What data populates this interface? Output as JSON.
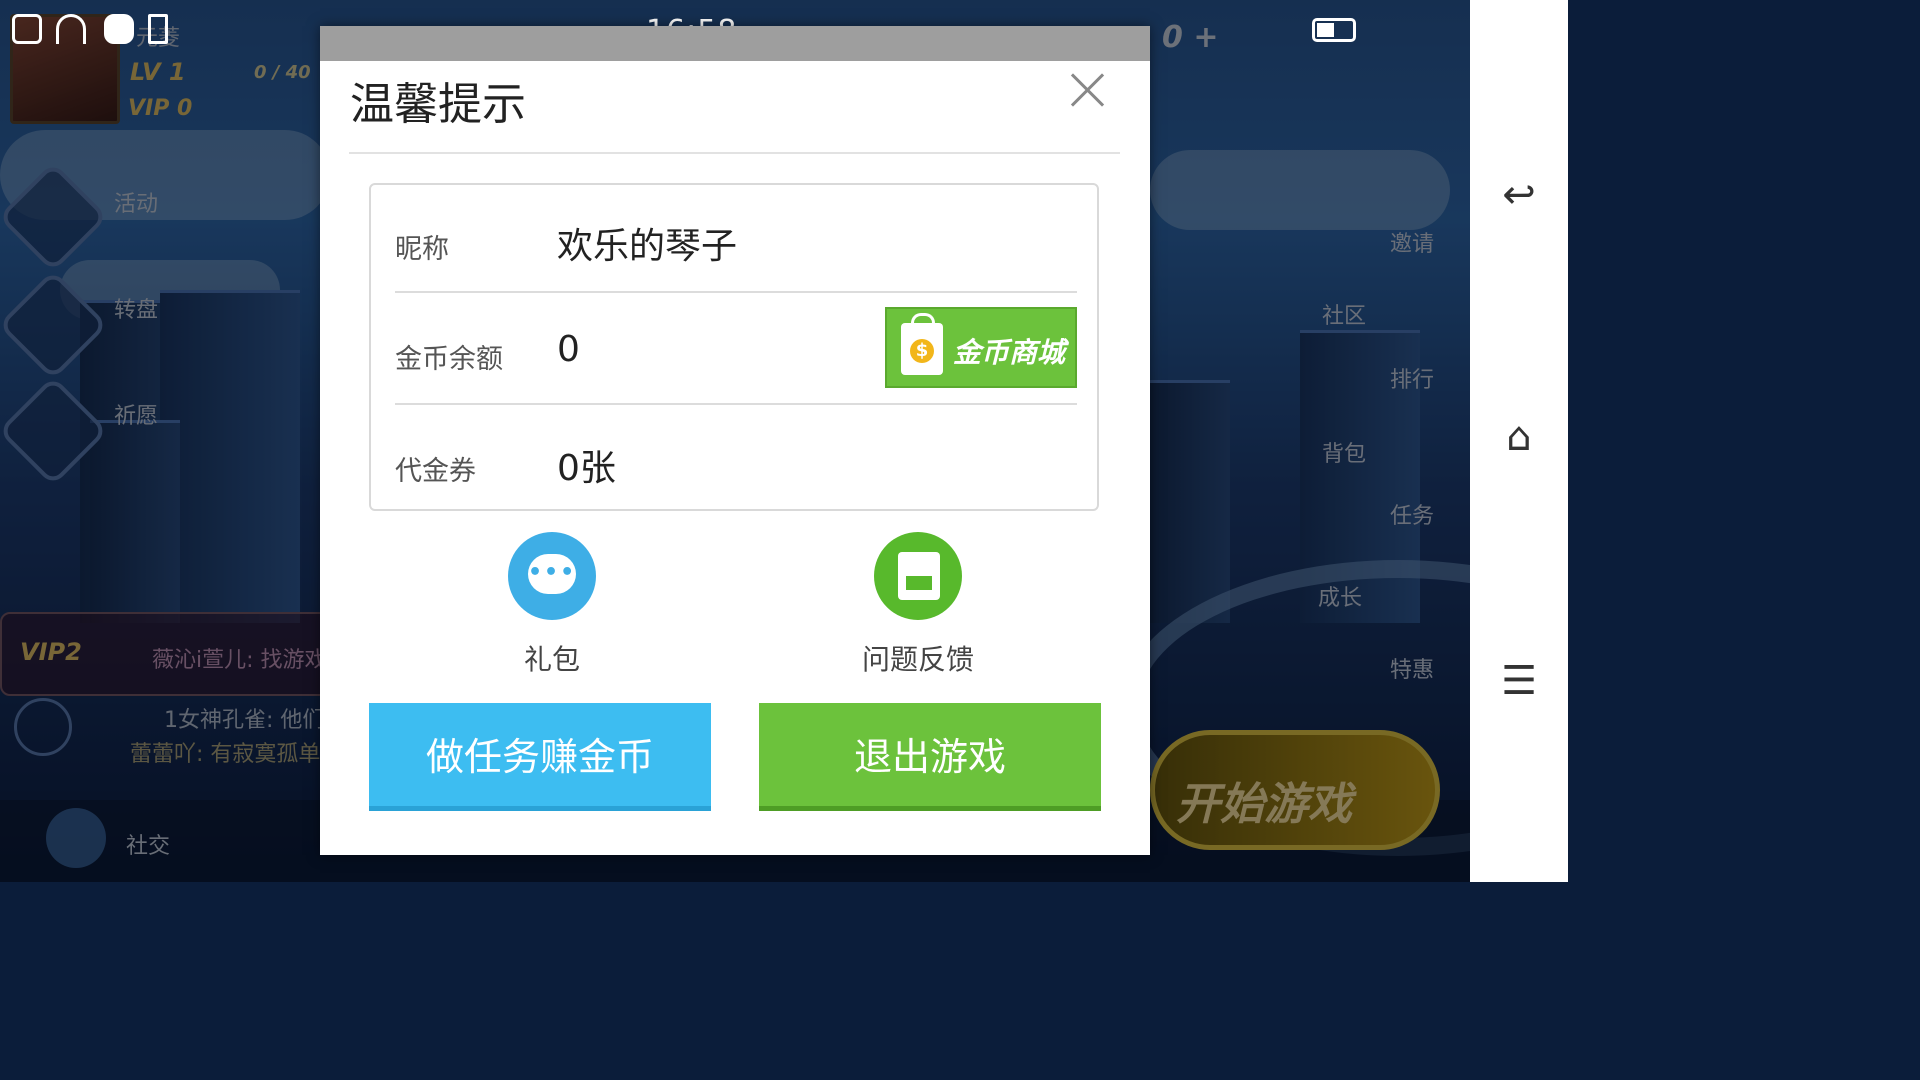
{
  "status_bar": {
    "time": "16:58"
  },
  "hud": {
    "player_name_fragment": "元菱",
    "level": "LV 1",
    "exp": "0 / 40",
    "vip": "VIP 0",
    "coins": "0 +"
  },
  "left_menu": [
    {
      "label": "活动"
    },
    {
      "label": "转盘"
    },
    {
      "label": "祈愿"
    }
  ],
  "chat": {
    "vip_badge": "VIP2",
    "line1": "薇沁i萱儿: 找游戏",
    "line2": "1女神孔雀: 他们",
    "line3": "蕾蕾吖: 有寂寞孤单"
  },
  "bottom_menu": [
    {
      "label": "社交"
    }
  ],
  "right_menu": [
    {
      "label": "邀请"
    },
    {
      "label": "社区"
    },
    {
      "label": "排行"
    },
    {
      "label": "背包"
    },
    {
      "label": "任务"
    },
    {
      "label": "成长"
    },
    {
      "label": "特惠"
    }
  ],
  "start_button": {
    "label": "开始游戏"
  },
  "dialog": {
    "title": "温馨提示",
    "nickname_label": "昵称",
    "nickname_value": "欢乐的琴子",
    "coin_label": "金币余额",
    "coin_value": "0",
    "shop_button": "金币商城",
    "voucher_label": "代金券",
    "voucher_value": "0张",
    "gift_label": "礼包",
    "feedback_label": "问题反馈",
    "task_button": "做任务赚金币",
    "exit_button": "退出游戏"
  },
  "colors": {
    "blue": "#3dbdf1",
    "green": "#6cc23c",
    "coin": "#f2b61a"
  },
  "icons": [
    "sim-icon",
    "wifi-icon",
    "android-icon",
    "usb-icon",
    "battery-icon",
    "close-icon",
    "shopping-bag-icon",
    "chat-bubble-icon",
    "feedback-icon",
    "back-icon",
    "home-icon",
    "menu-icon"
  ]
}
